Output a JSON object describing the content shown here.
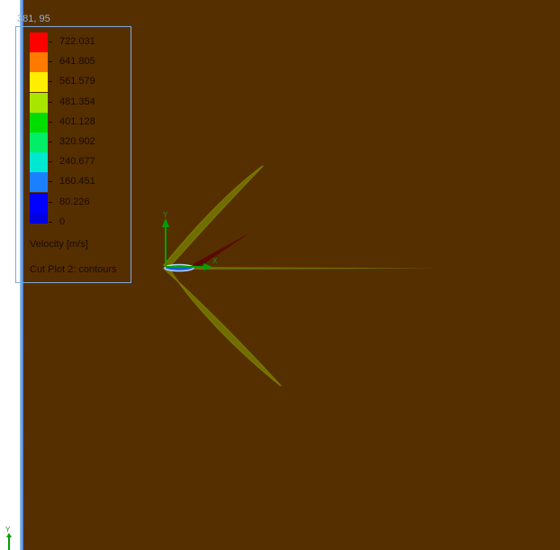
{
  "viewport": {
    "coordinate_readout": "381, 95",
    "background_color": "#562f00"
  },
  "legend": {
    "entries": [
      {
        "value": "722.031",
        "color": "#ff0000"
      },
      {
        "value": "641.805",
        "color": "#ff7a00"
      },
      {
        "value": "561.579",
        "color": "#ffee00"
      },
      {
        "value": "481.354",
        "color": "#a8e600"
      },
      {
        "value": "401.128",
        "color": "#00dd00"
      },
      {
        "value": "320.902",
        "color": "#00ee66"
      },
      {
        "value": "240.677",
        "color": "#00e8d0"
      },
      {
        "value": "160.451",
        "color": "#1b80ff"
      },
      {
        "value": "80.226",
        "color": "#0000ff"
      },
      {
        "value": "0",
        "color": "#0000e0"
      }
    ],
    "quantity_label": "Velocity [m/s]",
    "plot_label": "Cut Plot 2: contours"
  },
  "triad": {
    "y_label": "Y",
    "x_label": "X"
  },
  "corner_axis": {
    "y_label": "Y"
  }
}
